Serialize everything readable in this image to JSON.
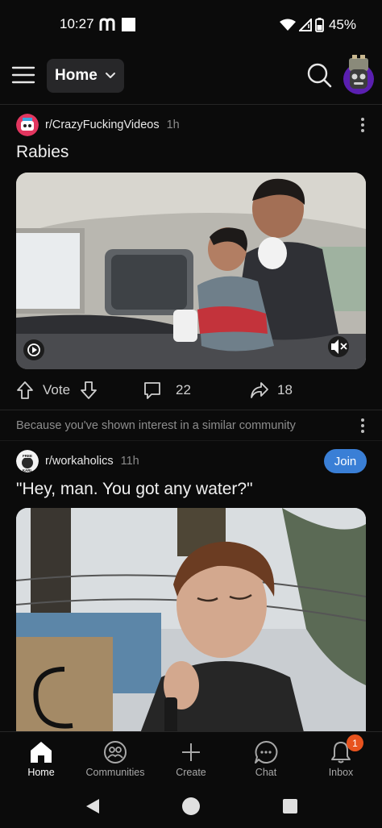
{
  "status_bar": {
    "time": "10:27",
    "battery": "45%"
  },
  "header": {
    "feed_label": "Home"
  },
  "posts": [
    {
      "subreddit": "r/CrazyFuckingVideos",
      "age": "1h",
      "title": "Rabies",
      "vote_label": "Vote",
      "comments": "22",
      "shares": "18"
    },
    {
      "recommendation": "Because you've shown interest in a similar community",
      "subreddit": "r/workaholics",
      "age": "11h",
      "join_label": "Join",
      "title": "\"Hey, man. You got any water?\""
    }
  ],
  "bottom_nav": {
    "items": [
      {
        "label": "Home"
      },
      {
        "label": "Communities"
      },
      {
        "label": "Create"
      },
      {
        "label": "Chat"
      },
      {
        "label": "Inbox"
      }
    ],
    "inbox_badge": "1"
  },
  "colors": {
    "background": "#0b0b0b",
    "join_button": "#3a7fd6",
    "badge": "#e8531e"
  }
}
